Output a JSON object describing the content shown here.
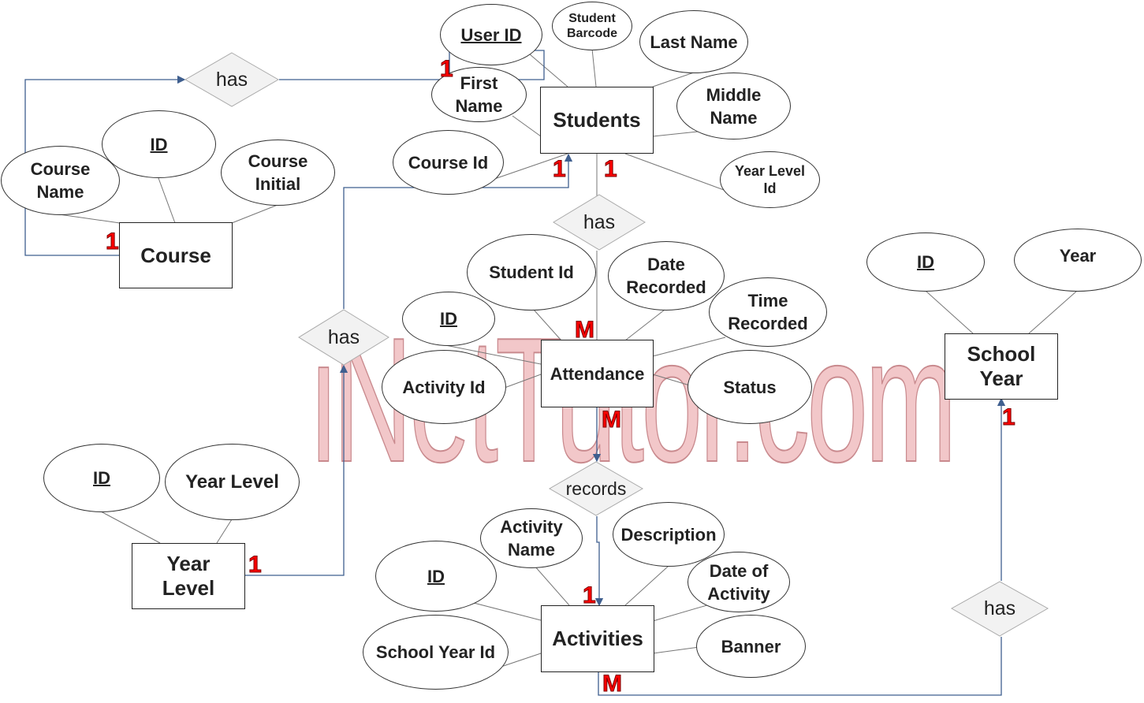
{
  "watermark": "iNetTutor.com",
  "entities": {
    "students": "Students",
    "course": "Course",
    "attendance": "Attendance",
    "activities": "Activities",
    "school_year": "School\nYear",
    "year_level": "Year\nLevel"
  },
  "relationships": {
    "course_students": "has",
    "students_attendance": "has",
    "yearlevel_students": "has",
    "attendance_activities": "records",
    "activities_schoolyear": "has"
  },
  "attributes": {
    "students": {
      "user_id": "User ID",
      "student_barcode": "Student Barcode",
      "last_name": "Last Name",
      "first_name": "First Name",
      "middle_name": "Middle Name",
      "course_id": "Course Id",
      "year_level_id": "Year Level Id"
    },
    "course": {
      "id": "ID",
      "course_name": "Course Name",
      "course_initial": "Course Initial"
    },
    "attendance": {
      "id": "ID",
      "student_id": "Student Id",
      "date_recorded": "Date Recorded",
      "time_recorded": "Time Recorded",
      "activity_id": "Activity Id",
      "status": "Status"
    },
    "activities": {
      "id": "ID",
      "activity_name": "Activity Name",
      "description": "Description",
      "date_of_activity": "Date of Activity",
      "school_year_id": "School Year Id",
      "banner": "Banner"
    },
    "school_year": {
      "id": "ID",
      "year": "Year"
    },
    "year_level": {
      "id": "ID",
      "year_level": "Year Level"
    }
  },
  "cardinalities": {
    "course_side": "1",
    "students_from_course": "1",
    "students_from_yearlevel": "1",
    "students_to_attendance": "1",
    "attendance_top": "M",
    "attendance_bottom": "M",
    "activities_top": "1",
    "activities_bottom": "M",
    "school_year": "1",
    "year_level": "1"
  }
}
